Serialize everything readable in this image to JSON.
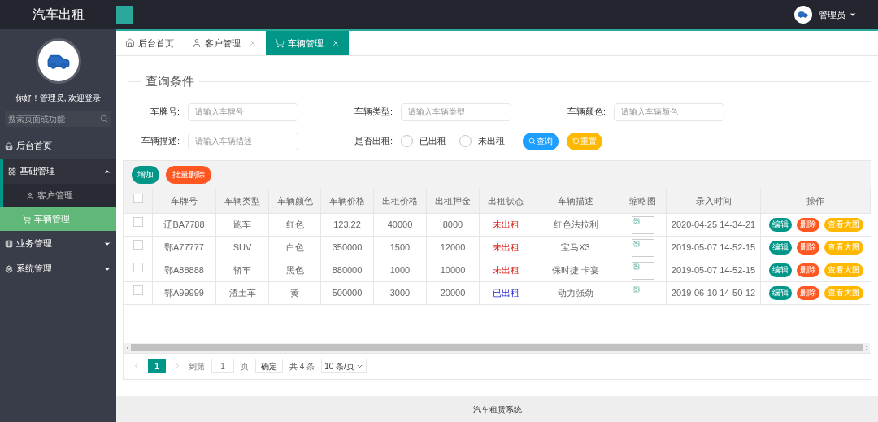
{
  "header": {
    "brand": "汽车出租",
    "user": "管理员"
  },
  "sidebar": {
    "greeting": "你好！管理员, 欢迎登录",
    "search_placeholder": "搜索页面或功能",
    "items": [
      {
        "label": "后台首页",
        "selected": false
      },
      {
        "label": "基础管理",
        "selected": false,
        "expanded": true,
        "children": [
          {
            "label": "客户管理",
            "selected": false
          },
          {
            "label": "车辆管理",
            "selected": true
          }
        ]
      },
      {
        "label": "业务管理",
        "selected": false,
        "expanded": false
      },
      {
        "label": "系统管理",
        "selected": false,
        "expanded": false
      }
    ]
  },
  "tabs": [
    {
      "label": "后台首页",
      "selected": false,
      "closable": false
    },
    {
      "label": "客户管理",
      "selected": false,
      "closable": true
    },
    {
      "label": "车辆管理",
      "selected": true,
      "closable": true
    }
  ],
  "query": {
    "legend": "查询条件",
    "fields": [
      {
        "label": "车牌号:",
        "placeholder": "请输入车牌号"
      },
      {
        "label": "车辆类型:",
        "placeholder": "请输入车辆类型"
      },
      {
        "label": "车辆颜色:",
        "placeholder": "请输入车辆颜色"
      },
      {
        "label": "车辆描述:",
        "placeholder": "请输入车辆描述"
      }
    ],
    "rent_filter": {
      "label": "是否出租:",
      "options": [
        {
          "label": "已出租",
          "selected": false
        },
        {
          "label": "未出租",
          "selected": false
        }
      ]
    },
    "search_button": "查询",
    "reset_button": "重置"
  },
  "table": {
    "add_button": "增加",
    "batch_delete_button": "批量删除",
    "select_all_checked": false,
    "columns": [
      "车牌号",
      "车辆类型",
      "车辆颜色",
      "车辆价格",
      "出租价格",
      "出租押金",
      "出租状态",
      "车辆描述",
      "缩略图",
      "录入时间",
      "操作"
    ],
    "rows": [
      {
        "checked": false,
        "cells": [
          "辽BA7788",
          "跑车",
          "红色",
          "123.22",
          "40000",
          "8000"
        ],
        "status": "未出租",
        "rented": false,
        "description": "红色法拉利",
        "time": "2020-04-25 14-34-21",
        "actions": [
          "编辑",
          "删除",
          "查看大图"
        ]
      },
      {
        "checked": false,
        "cells": [
          "鄂A77777",
          "SUV",
          "白色",
          "350000",
          "1500",
          "12000"
        ],
        "status": "未出租",
        "rented": false,
        "description": "宝马X3",
        "time": "2019-05-07 14-52-15",
        "actions": [
          "编辑",
          "删除",
          "查看大图"
        ]
      },
      {
        "checked": false,
        "cells": [
          "鄂A88888",
          "轿车",
          "黑色",
          "880000",
          "1000",
          "10000"
        ],
        "status": "未出租",
        "rented": false,
        "description": "保时捷 卡宴",
        "time": "2019-05-07 14-52-15",
        "actions": [
          "编辑",
          "删除",
          "查看大图"
        ]
      },
      {
        "checked": false,
        "cells": [
          "鄂A99999",
          "渣土车",
          "黄",
          "500000",
          "3000",
          "20000"
        ],
        "status": "已出租",
        "rented": true,
        "description": "动力强劲",
        "time": "2019-06-10 14-50-12",
        "actions": [
          "编辑",
          "删除",
          "查看大图"
        ]
      }
    ]
  },
  "pagination": {
    "pages": [
      {
        "label": "1",
        "selected": true
      }
    ],
    "goto_label": "到第",
    "goto_value": "1",
    "page_label": "页",
    "confirm": "确定",
    "total": "共 4 条",
    "page_size": "10 条/页"
  },
  "footer": "汽车租赁系统"
}
